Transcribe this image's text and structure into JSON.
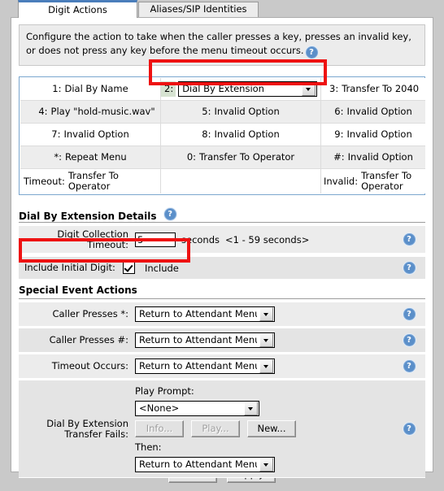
{
  "tabs": [
    {
      "label": "Digit Actions",
      "active": true
    },
    {
      "label": "Aliases/SIP Identities",
      "active": false
    }
  ],
  "instructions": {
    "line1": "Configure the action to take when the caller presses a key, presses an invalid key,",
    "line2": "or does not press any key before the menu timeout occurs.",
    "help_icon": "help-icon"
  },
  "digit_grid": {
    "rows": [
      {
        "cells": [
          {
            "key": "1:",
            "value": "Dial By Name",
            "type": "text"
          },
          {
            "key": "2:",
            "value": "Dial By Extension",
            "type": "select",
            "highlighted": true
          },
          {
            "key": "3:",
            "value": "Transfer To 2040",
            "type": "text"
          }
        ]
      },
      {
        "cells": [
          {
            "key": "4:",
            "value": "Play \"hold-music.wav\"",
            "type": "text"
          },
          {
            "key": "5:",
            "value": "Invalid Option",
            "type": "text"
          },
          {
            "key": "6:",
            "value": "Invalid Option",
            "type": "text"
          }
        ]
      },
      {
        "cells": [
          {
            "key": "7:",
            "value": "Invalid Option",
            "type": "text"
          },
          {
            "key": "8:",
            "value": "Invalid Option",
            "type": "text"
          },
          {
            "key": "9:",
            "value": "Invalid Option",
            "type": "text"
          }
        ]
      },
      {
        "cells": [
          {
            "key": "*:",
            "value": "Repeat Menu",
            "type": "text"
          },
          {
            "key": "0:",
            "value": "Transfer To Operator",
            "type": "text"
          },
          {
            "key": "#:",
            "value": "Invalid Option",
            "type": "text"
          }
        ]
      },
      {
        "cells": [
          {
            "key": "Timeout:",
            "value": "Transfer To Operator",
            "type": "text"
          },
          {
            "key": "",
            "value": "",
            "type": "text"
          },
          {
            "key": "Invalid:",
            "value": "Transfer To Operator",
            "type": "text"
          }
        ]
      }
    ]
  },
  "details_section": {
    "title": "Dial By Extension Details",
    "digit_collection_timeout": {
      "label": "Digit Collection Timeout:",
      "value": "5",
      "unit": "seconds",
      "hint": "<1 - 59 seconds>"
    },
    "include_initial_digit": {
      "label": "Include Initial Digit:",
      "checkbox_label": "Include",
      "checked": true,
      "highlighted": true
    }
  },
  "special_events": {
    "title": "Special Event Actions",
    "rows": [
      {
        "label": "Caller Presses *:",
        "value": "Return to Attendant Menu"
      },
      {
        "label": "Caller Presses #:",
        "value": "Return to Attendant Menu"
      },
      {
        "label": "Timeout Occurs:",
        "value": "Return to Attendant Menu"
      }
    ],
    "transfer_fails": {
      "label": "Dial By Extension Transfer Fails:",
      "play_prompt_label": "Play Prompt:",
      "play_prompt_value": "<None>",
      "buttons": [
        {
          "label": "Info...",
          "disabled": true
        },
        {
          "label": "Play...",
          "disabled": true
        },
        {
          "label": "New...",
          "disabled": false
        }
      ],
      "then_label": "Then:",
      "then_value": "Return to Attendant Menu"
    }
  },
  "footer": {
    "cancel_label": "Cancel",
    "apply_label": "Apply"
  },
  "colors": {
    "highlight": "#ee1111",
    "accent": "#4a7ebb",
    "help_icon": "#5b8fc9",
    "key_badge": "#d6e3d1"
  }
}
